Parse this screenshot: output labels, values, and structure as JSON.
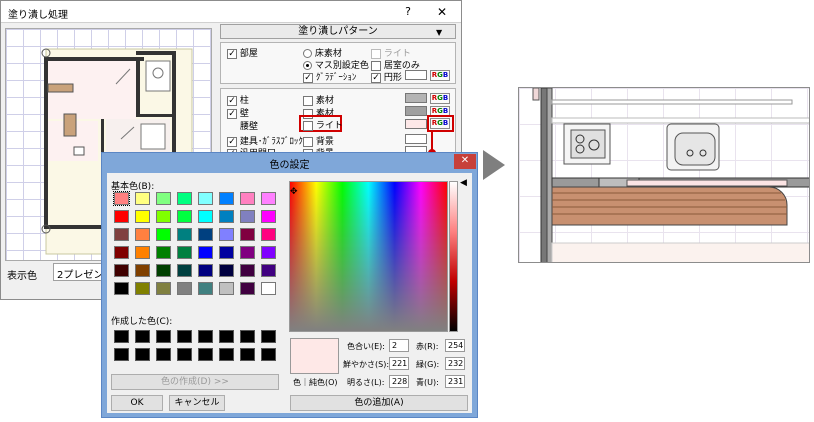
{
  "main_dialog": {
    "title": "塗り潰し処理",
    "help": "?",
    "close": "✕",
    "display_color_label": "表示色",
    "display_color_value": "2プレゼンテ",
    "pattern_dropdown": "塗り潰しパターン",
    "room": {
      "label": "部屋",
      "opt_floor_material": "床素材",
      "opt_light": "ライト",
      "opt_mass_color": "マス別設定色",
      "opt_rooms_only": "居室のみ",
      "opt_gradation": "ｸﾞﾗﾃﾞｰｼｮﾝ",
      "opt_circle": "円形"
    },
    "parts": {
      "pillar": "柱",
      "wall": "壁",
      "waist_wall": "腰壁",
      "fixtures": "建具･ｶﾞﾗｽﾌﾞﾛｯｸ",
      "general_opening": "汎用開口",
      "material": "素材",
      "light": "ライト",
      "background": "背景"
    },
    "rgb": {
      "r": "R",
      "g": "G",
      "b": "B"
    }
  },
  "color_dialog": {
    "title": "色の設定",
    "basic_colors_label": "基本色(B):",
    "custom_colors_label": "作成した色(C):",
    "define_custom": "色の作成(D) >>",
    "ok": "OK",
    "cancel": "キャンセル",
    "color_solid": "色｜純色(O)",
    "add_to_custom": "色の追加(A)",
    "hue_label": "色合い(E):",
    "hue": "2",
    "sat_label": "鮮やかさ(S):",
    "sat": "221",
    "lum_label": "明るさ(L):",
    "lum": "228",
    "red_label": "赤(R):",
    "red": "254",
    "green_label": "緑(G):",
    "green": "232",
    "blue_label": "青(U):",
    "blue": "231"
  },
  "colors": {
    "highlight": "#d00000",
    "selected_color": "#fee8e7",
    "swatch_pillar": "#b4b4b4",
    "swatch_wall": "#a0a0a0",
    "swatch_waist": "#fde8e8",
    "basic_palette": [
      "#ff8080",
      "#ffff80",
      "#80ff80",
      "#00ff80",
      "#80ffff",
      "#0080ff",
      "#ff80c0",
      "#ff80ff",
      "#ff0000",
      "#ffff00",
      "#80ff00",
      "#00ff40",
      "#00ffff",
      "#0080c0",
      "#8080c0",
      "#ff00ff",
      "#804040",
      "#ff8040",
      "#00ff00",
      "#008080",
      "#004080",
      "#8080ff",
      "#800040",
      "#ff0080",
      "#800000",
      "#ff8000",
      "#008000",
      "#008040",
      "#0000ff",
      "#0000a0",
      "#800080",
      "#8000ff",
      "#400000",
      "#804000",
      "#004000",
      "#004040",
      "#000080",
      "#000040",
      "#400040",
      "#400080",
      "#000000",
      "#808000",
      "#808040",
      "#808080",
      "#408080",
      "#c0c0c0",
      "#400040",
      "#ffffff"
    ]
  }
}
